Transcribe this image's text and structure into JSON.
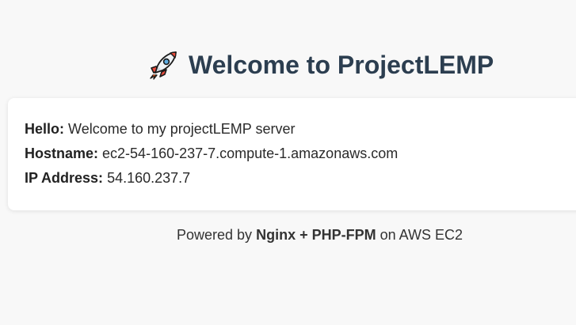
{
  "header": {
    "title": "Welcome to ProjectLEMP",
    "icon": "rocket-icon"
  },
  "info": {
    "hello_label": "Hello:",
    "hello_value": "Welcome to my projectLEMP server",
    "hostname_label": "Hostname:",
    "hostname_value": "ec2-54-160-237-7.compute-1.amazonaws.com",
    "ip_label": "IP Address:",
    "ip_value": "54.160.237.7"
  },
  "footer": {
    "prefix": "Powered by",
    "stack": "Nginx + PHP-FPM",
    "suffix": "on AWS EC2"
  },
  "colors": {
    "background": "#f8f8f8",
    "title": "#2c3e50",
    "card": "#ffffff"
  }
}
